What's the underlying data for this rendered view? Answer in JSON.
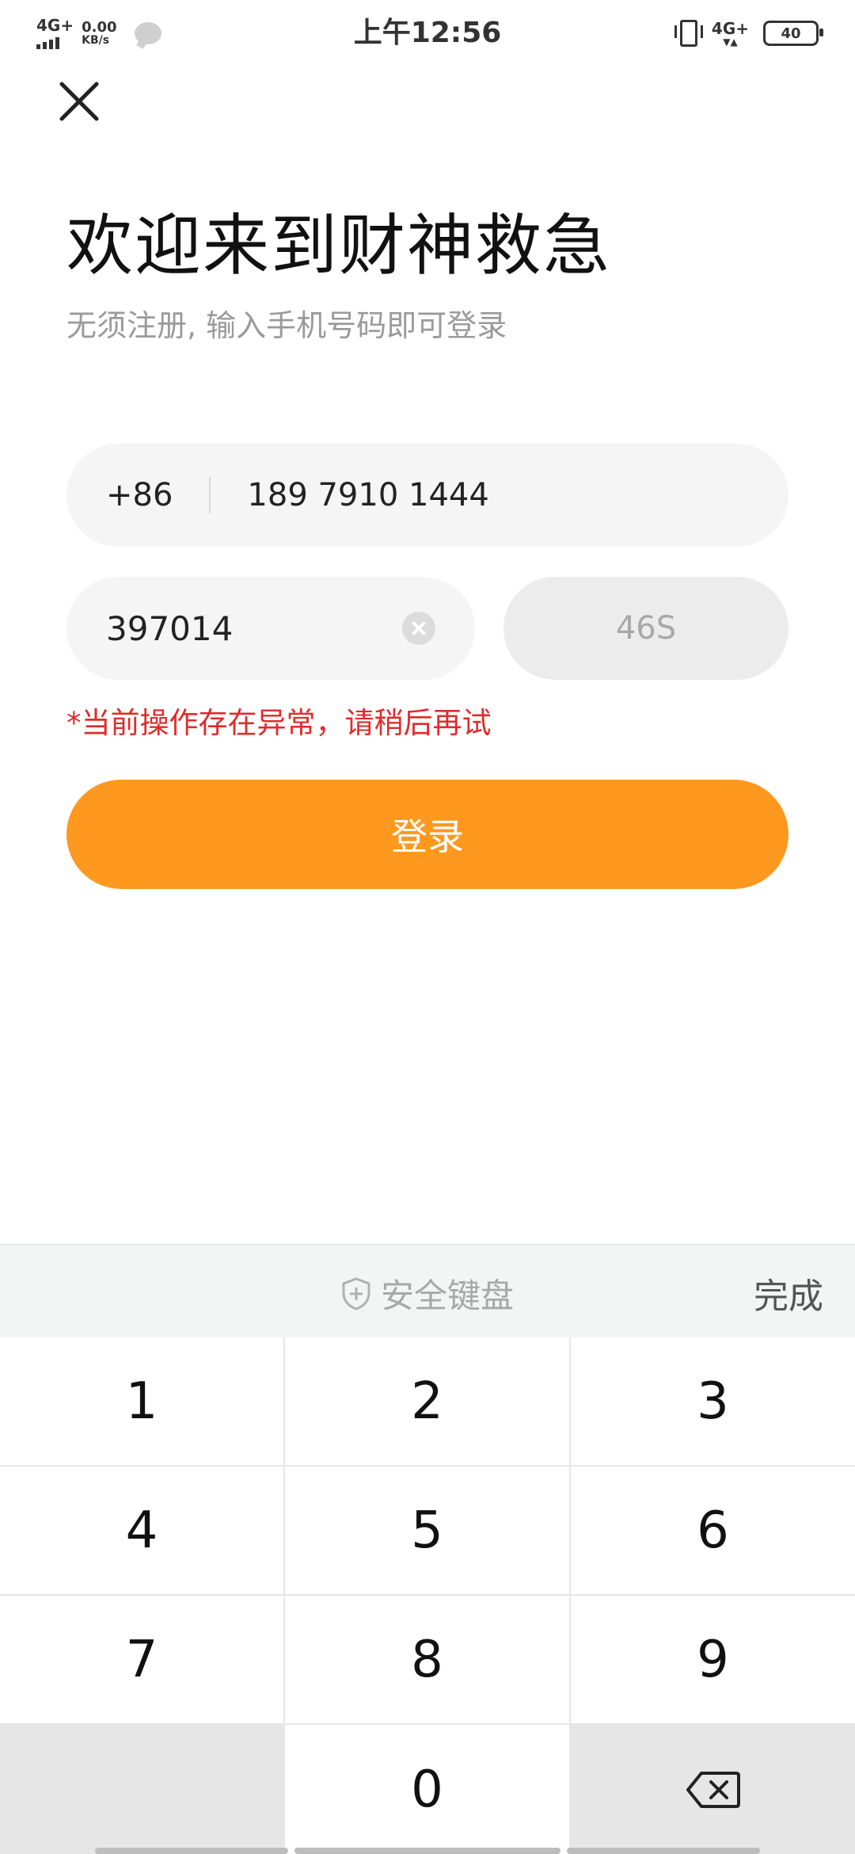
{
  "status_bar": {
    "network_left": "4G+",
    "speed_value": "0.00",
    "speed_unit": "KB/s",
    "time": "上午12:56",
    "network_right": "4G+",
    "battery": "40"
  },
  "header": {
    "title": "欢迎来到财神救急",
    "subtitle": "无须注册, 输入手机号码即可登录"
  },
  "form": {
    "country_code": "+86",
    "phone_value": "189 7910 1444",
    "code_value": "397014",
    "countdown": "46S",
    "error_message": "*当前操作存在异常，请稍后再试",
    "login_label": "登录"
  },
  "keyboard": {
    "title": "安全键盘",
    "done_label": "完成",
    "keys": [
      "1",
      "2",
      "3",
      "4",
      "5",
      "6",
      "7",
      "8",
      "9",
      "0"
    ]
  },
  "colors": {
    "accent": "#ff981e",
    "error": "#e02b2b"
  }
}
